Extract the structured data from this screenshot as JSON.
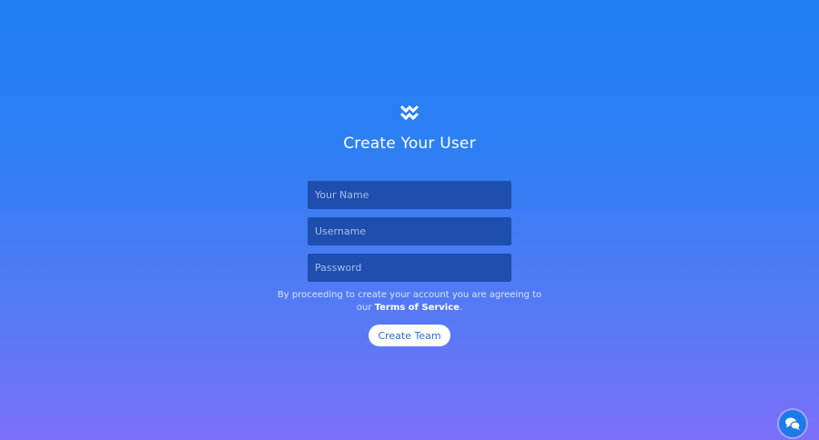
{
  "page": {
    "title": "Create Your User",
    "logo_icon": "double-chevron-logo-icon"
  },
  "form": {
    "name_placeholder": "Your Name",
    "username_placeholder": "Username",
    "password_placeholder": "Password",
    "terms_prefix": "By proceeding to create your account you are agreeing to our ",
    "terms_link": "Terms of Service",
    "terms_suffix": ".",
    "submit_label": "Create Team"
  },
  "chat": {
    "icon": "chat-bubbles-icon"
  },
  "colors": {
    "gradient_top": "#1f7ff2",
    "gradient_bottom": "#7b6ff8",
    "field_bg": "#1f4fae",
    "button_text": "#2d6ad6"
  }
}
